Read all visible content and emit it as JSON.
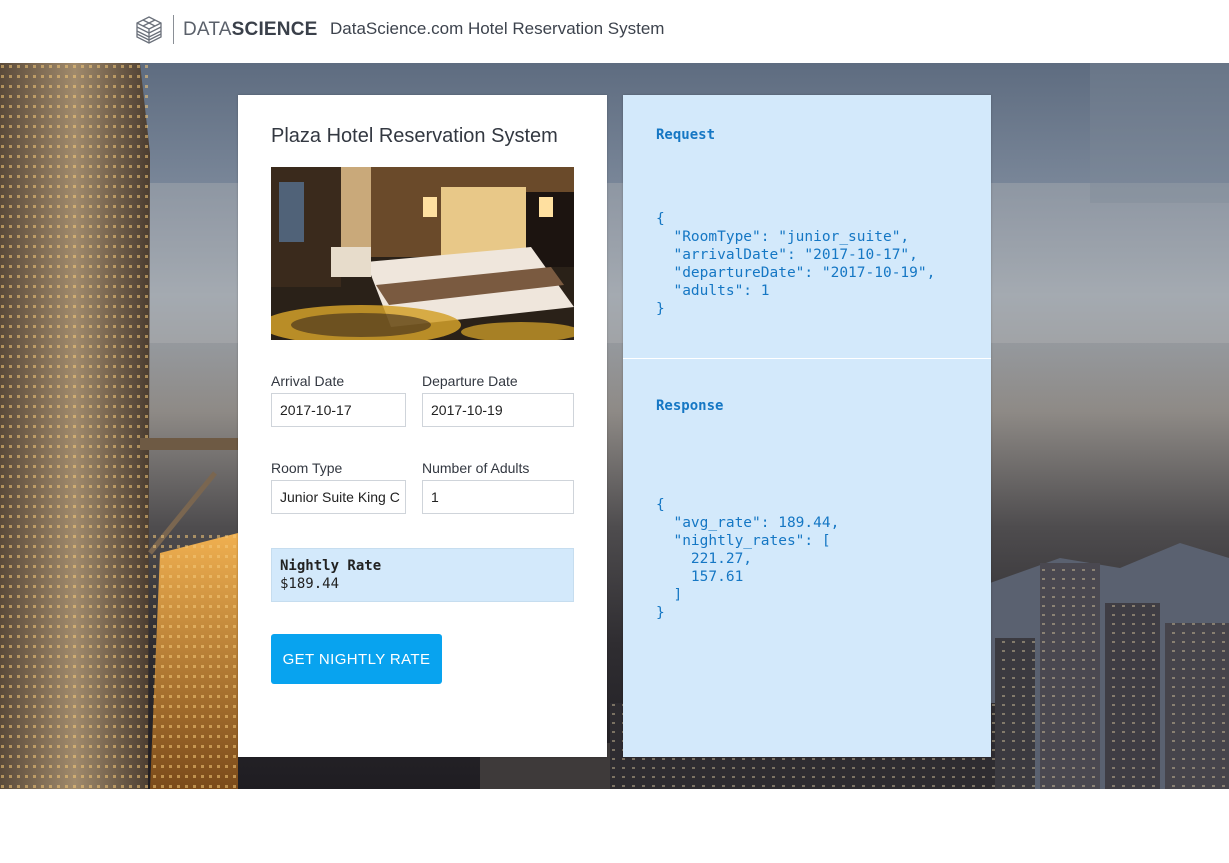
{
  "header": {
    "logo_light": "DATA",
    "logo_bold": "SCIENCE",
    "site_title": "DataScience.com Hotel Reservation System"
  },
  "form": {
    "title": "Plaza Hotel Reservation System",
    "arrival_label": "Arrival Date",
    "arrival_value": "2017-10-17",
    "departure_label": "Departure Date",
    "departure_value": "2017-10-19",
    "room_type_label": "Room Type",
    "room_type_value": "Junior Suite King C",
    "adults_label": "Number of Adults",
    "adults_value": "1",
    "rate_title": "Nightly Rate",
    "rate_value": "$189.44",
    "button_label": "GET NIGHTLY RATE"
  },
  "api": {
    "request_label": "Request",
    "request_body": "{\n  \"RoomType\": \"junior_suite\",\n  \"arrivalDate\": \"2017-10-17\",\n  \"departureDate\": \"2017-10-19\",\n  \"adults\": 1\n}",
    "response_label": "Response",
    "response_body": "{\n  \"avg_rate\": 189.44,\n  \"nightly_rates\": [\n    221.27,\n    157.61\n  ]\n}"
  },
  "colors": {
    "accent": "#08a3ef",
    "panel": "#d3e9fb",
    "code": "#1577c4"
  }
}
